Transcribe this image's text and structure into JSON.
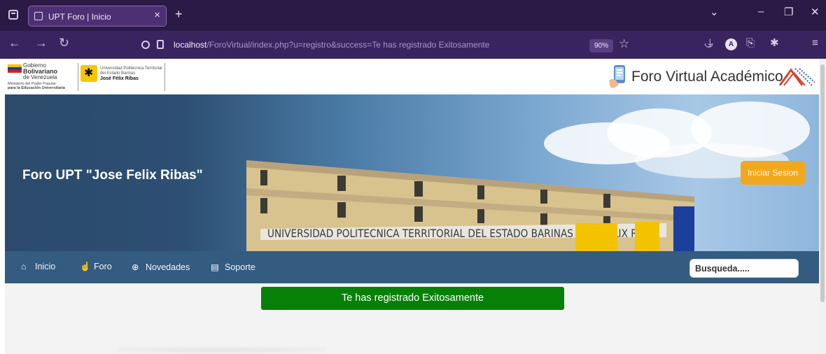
{
  "browser": {
    "tab_title": "UPT Foro | Inicio",
    "tab_close": "×",
    "new_tab": "+",
    "url_host": "localhost",
    "url_path": "/ForoVirtual/index.php?u=registro&success=Te has registrado Exitosamente",
    "zoom": "90%",
    "account_initial": "A"
  },
  "header": {
    "gov_line1": "Gobierno",
    "gov_line2": "Bolivariano",
    "gov_line3": "de Venezuela",
    "gov_sub1": "Ministerio del Poder Popular",
    "gov_sub2": "para la Educación Universitaria",
    "upt_line1": "Universidad Politécnica Territorial",
    "upt_line2": "del Estado Barinas",
    "upt_line3": "José Félix Ribas",
    "brand_title": "Foro Virtual Académico"
  },
  "hero": {
    "title": "Foro UPT \"Jose Felix Ribas\"",
    "building_sign": "UNIVERSIDAD POLITECNICA TERRITORIAL DEL ESTADO BARINAS JOSE FELIX RIBAS",
    "login_label": "Iniciar Sesion"
  },
  "menu": {
    "items": [
      {
        "label": "Inicio",
        "icon": "home-icon"
      },
      {
        "label": "Foro",
        "icon": "pointer-hand-icon"
      },
      {
        "label": "Novedades",
        "icon": "globe-icon"
      },
      {
        "label": "Soporte",
        "icon": "support-doc-icon"
      }
    ],
    "search_placeholder": "Busqueda....."
  },
  "alert": {
    "message": "Te has registrado Exitosamente",
    "color": "#078007"
  },
  "colors": {
    "browser_tabbar": "#2b1a45",
    "browser_navbar": "#3a2460",
    "menubar": "#345b80",
    "login_button": "#f2a81d"
  }
}
